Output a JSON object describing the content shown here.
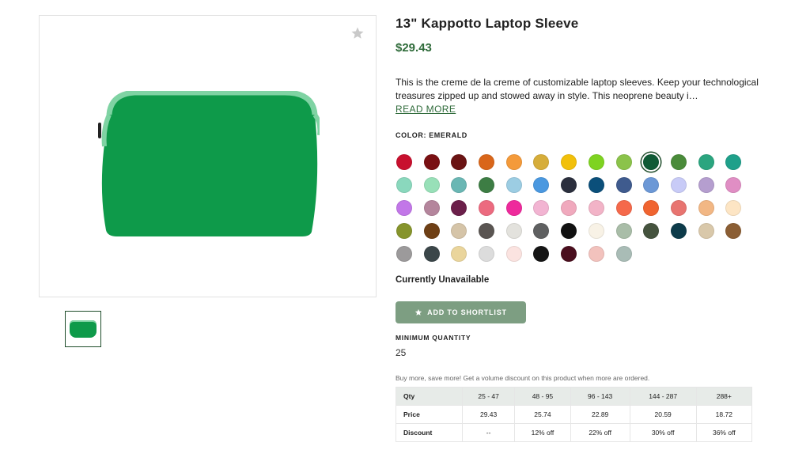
{
  "product": {
    "title": "13\" Kappotto Laptop Sleeve",
    "price": "$29.43",
    "description": "This is the creme de la creme of customizable laptop sleeves. Keep your technological treasures zipped up and stowed away in style. This neoprene beauty i…",
    "read_more": "READ MORE",
    "color_label": "COLOR: EMERALD",
    "image_color": "#0e9a4a",
    "zip_trim_color": "#7fd3a3"
  },
  "swatches": [
    "#c8102e",
    "#7a1013",
    "#6b1414",
    "#d9661a",
    "#f49a3a",
    "#d6ad3a",
    "#f2c00a",
    "#7ed321",
    "#8bc34a",
    "#0f5a35",
    "#4a8b3a",
    "#2ba57f",
    "#1fa08a",
    "#8ad8bd",
    "#98e0b8",
    "#6ab7b4",
    "#3d7d44",
    "#9ccde3",
    "#4a98e0",
    "#2b2f3d",
    "#0b4f7a",
    "#3f5b8e",
    "#6c98d6",
    "#c8cbf7",
    "#b59ecf",
    "#e08ec4",
    "#c277e8",
    "#b4859c",
    "#6b1f4a",
    "#ec6a7f",
    "#ee2a9c",
    "#f2b4d2",
    "#f0a9bd",
    "#f2b3c7",
    "#f5694b",
    "#f06430",
    "#e87470",
    "#f2b784",
    "#fde5c4",
    "#86942c",
    "#6e3f15",
    "#d5c4a8",
    "#5a5552",
    "#e3e2dd",
    "#5f6061",
    "#111111",
    "#f8f2e6",
    "#a9bda8",
    "#45533e",
    "#0d3b4a",
    "#d9c8aa",
    "#8b5e34",
    "#9c9a9b",
    "#3b4649",
    "#ead59c",
    "#dcdcdc",
    "#fbe3e0",
    "#151515",
    "#4a0f1e",
    "#f2c2bd",
    "#a9bcb6"
  ],
  "selected_swatch_index": 9,
  "availability": "Currently Unavailable",
  "shortlist_button": "ADD TO SHORTLIST",
  "minimum": {
    "label": "MINIMUM QUANTITY",
    "value": "25"
  },
  "volume_note": "Buy more, save more! Get a volume discount on this product when more are ordered.",
  "pricing_table": {
    "rows": [
      [
        "Qty",
        "25 - 47",
        "48 - 95",
        "96 - 143",
        "144 - 287",
        "288+"
      ],
      [
        "Price",
        "29.43",
        "25.74",
        "22.89",
        "20.59",
        "18.72"
      ],
      [
        "Discount",
        "--",
        "12% off",
        "22% off",
        "30% off",
        "36% off"
      ]
    ]
  },
  "colors": {
    "accent": "#2f6b3a",
    "button": "#7d9e82",
    "table_head": "#e7ebe8"
  },
  "icons": {
    "favorite": "star-icon",
    "shortlist": "star-icon"
  }
}
